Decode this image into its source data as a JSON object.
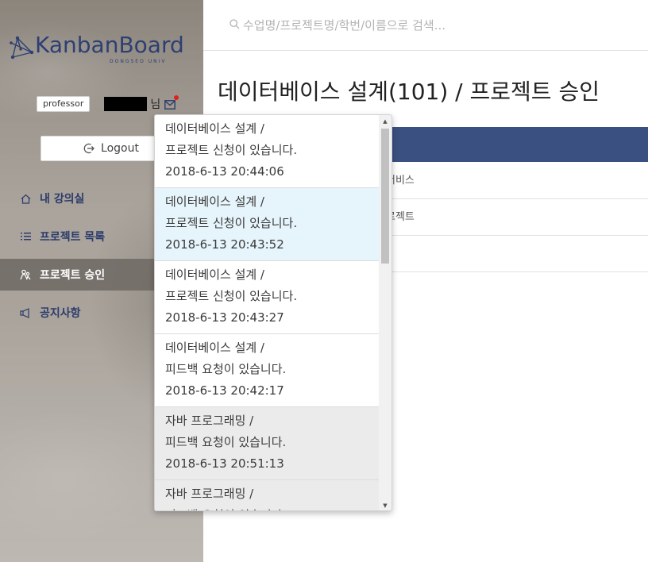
{
  "brand": {
    "name": "KanbanBoard",
    "subtitle": "DONGSEO UNIV"
  },
  "user": {
    "role": "professor",
    "suffix": "님",
    "has_new_message": true
  },
  "logout": {
    "label": "Logout"
  },
  "nav": {
    "items": [
      {
        "label": "내 강의실",
        "icon": "home-icon",
        "active": false
      },
      {
        "label": "프로젝트 목록",
        "icon": "list-icon",
        "active": false
      },
      {
        "label": "프로젝트 승인",
        "icon": "people-icon",
        "active": true
      },
      {
        "label": "공지사항",
        "icon": "megaphone-icon",
        "active": false
      }
    ]
  },
  "search": {
    "placeholder": "수업명/프로젝트명/학번/이름으로 검색..."
  },
  "page": {
    "title": "데이터베이스 설계(101) / 프로젝트 승인"
  },
  "table": {
    "rows": [
      {
        "text": "서비스"
      },
      {
        "text": "로젝트"
      },
      {
        "text": ""
      }
    ]
  },
  "notifications": [
    {
      "course": "데이터베이스 설계 /",
      "message": "프로젝트 신청이 있습니다.",
      "time": "2018-6-13 20:44:06",
      "state": "unread"
    },
    {
      "course": "데이터베이스 설계 /",
      "message": "프로젝트 신청이 있습니다.",
      "time": "2018-6-13 20:43:52",
      "state": "hover"
    },
    {
      "course": "데이터베이스 설계 /",
      "message": "프로젝트 신청이 있습니다.",
      "time": "2018-6-13 20:43:27",
      "state": "unread"
    },
    {
      "course": "데이터베이스 설계 /",
      "message": "피드백 요청이 있습니다.",
      "time": "2018-6-13 20:42:17",
      "state": "unread"
    },
    {
      "course": "자바 프로그래밍 /",
      "message": "피드백 요청이 있습니다.",
      "time": "2018-6-13 20:51:13",
      "state": "read"
    },
    {
      "course": "자바 프로그래밍 /",
      "message": "피드백 요청이 있습니다.",
      "time": "",
      "state": "read"
    }
  ],
  "colors": {
    "brand": "#2d3f73",
    "table_header": "#3a5080",
    "badge_dot": "#e0201b",
    "hover_row": "#e6f4fb",
    "read_row": "#ebebeb"
  }
}
